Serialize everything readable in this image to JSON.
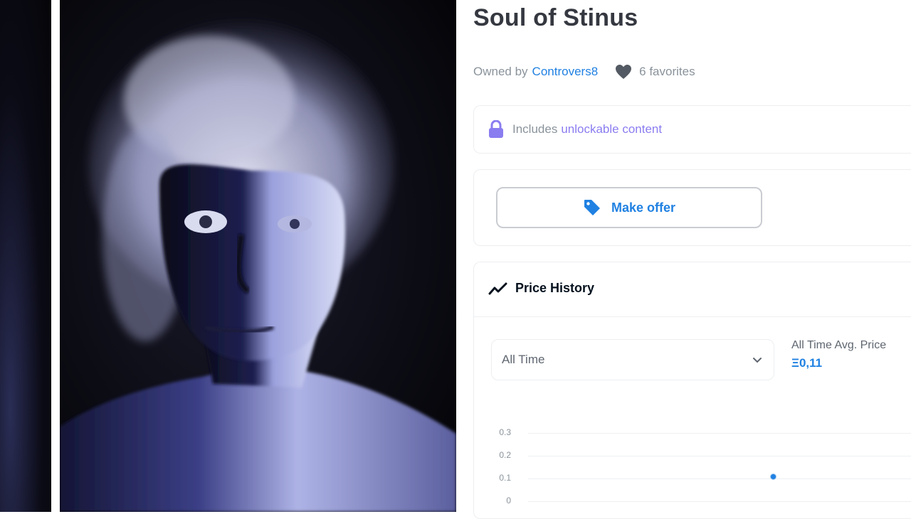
{
  "item": {
    "title": "Soul of Stinus",
    "owned_by_prefix": "Owned by",
    "owner": "Controvers8",
    "favorites": "6 favorites"
  },
  "unlockable": {
    "prefix": "Includes",
    "link": "unlockable content"
  },
  "offer": {
    "button_label": "Make offer"
  },
  "price_history": {
    "title": "Price History",
    "time_range": "All Time",
    "avg_label": "All Time Avg. Price",
    "avg_value": "Ξ0,11"
  },
  "chart_data": {
    "type": "scatter",
    "y_ticks": [
      "0.3",
      "0.2",
      "0.1",
      "0"
    ],
    "ylim": [
      0,
      0.3
    ],
    "points": [
      {
        "y": 0.11
      }
    ],
    "grid": true
  },
  "colors": {
    "accent": "#2081e2",
    "unlock_accent": "#8a7df0",
    "title": "#353840",
    "muted": "#8a939b"
  },
  "icons": {
    "heart": "heart-icon",
    "lock": "lock-icon",
    "tag": "tag-icon",
    "trend": "trending-icon",
    "chevron": "chevron-down-icon"
  }
}
